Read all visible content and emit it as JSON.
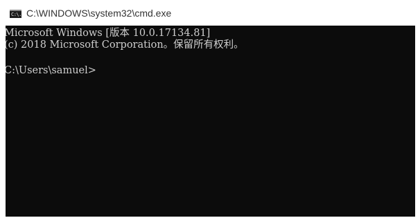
{
  "window": {
    "title": "C:\\WINDOWS\\system32\\cmd.exe",
    "icon": "cmd-icon",
    "icon_text": "C:\\."
  },
  "console": {
    "lines": [
      "Microsoft Windows [版本 10.0.17134.81]",
      "(c) 2018 Microsoft Corporation。保留所有权利。"
    ],
    "prompt": "C:\\Users\\samuel>",
    "background_color": "#0c0c0c",
    "text_color": "#cccccc"
  }
}
